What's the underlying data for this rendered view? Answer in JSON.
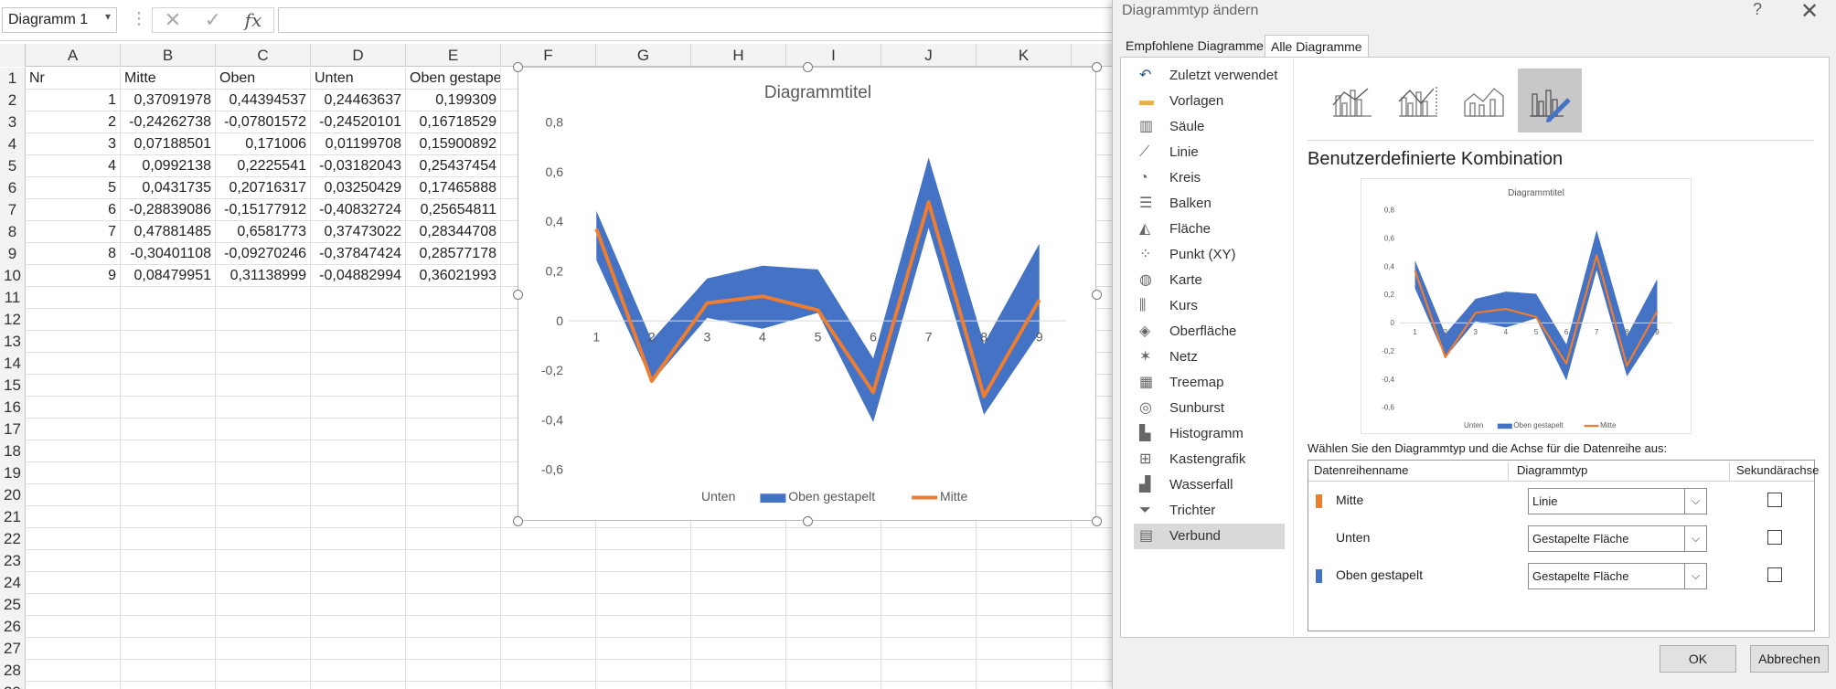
{
  "formula_bar": {
    "name_box": "Diagramm 1",
    "formula": ""
  },
  "columns": [
    "A",
    "B",
    "C",
    "D",
    "E",
    "F",
    "G",
    "H",
    "I",
    "J",
    "K"
  ],
  "row_numbers": [
    "1",
    "2",
    "3",
    "4",
    "5",
    "6",
    "7",
    "8",
    "9",
    "10",
    "11",
    "12",
    "13",
    "14",
    "15",
    "16",
    "17",
    "18",
    "19",
    "20",
    "21",
    "22",
    "23",
    "24",
    "25",
    "26",
    "27",
    "28",
    "29"
  ],
  "table": {
    "headers": [
      "Nr",
      "Mitte",
      "Oben",
      "Unten",
      "Oben gestapelt"
    ],
    "rows": [
      [
        "1",
        "0,37091978",
        "0,44394537",
        "0,24463637",
        "0,199309"
      ],
      [
        "2",
        "-0,24262738",
        "-0,07801572",
        "-0,24520101",
        "0,16718529"
      ],
      [
        "3",
        "0,07188501",
        "0,171006",
        "0,01199708",
        "0,15900892"
      ],
      [
        "4",
        "0,0992138",
        "0,2225541",
        "-0,03182043",
        "0,25437454"
      ],
      [
        "5",
        "0,0431735",
        "0,20716317",
        "0,03250429",
        "0,17465888"
      ],
      [
        "6",
        "-0,28839086",
        "-0,15177912",
        "-0,40832724",
        "0,25654811"
      ],
      [
        "7",
        "0,47881485",
        "0,6581773",
        "0,37473022",
        "0,28344708"
      ],
      [
        "8",
        "-0,30401108",
        "-0,09270246",
        "-0,37847424",
        "0,28577178"
      ],
      [
        "9",
        "0,08479951",
        "0,31138999",
        "-0,04882994",
        "0,36021993"
      ]
    ]
  },
  "chart_data": {
    "type": "line",
    "title": "Diagrammtitel",
    "categories": [
      "1",
      "2",
      "3",
      "4",
      "5",
      "6",
      "7",
      "8",
      "9"
    ],
    "ylim": [
      -0.6,
      0.8
    ],
    "yticks": [
      0.8,
      0.6,
      0.4,
      0.2,
      0,
      -0.2,
      -0.4,
      -0.6
    ],
    "ytick_labels": [
      "0,8",
      "0,6",
      "0,4",
      "0,2",
      "0",
      "-0,2",
      "-0,4",
      "-0,6"
    ],
    "legend_position": "bottom",
    "series": [
      {
        "name": "Unten",
        "kind": "stacked-area",
        "color": "none",
        "values": [
          0.24463637,
          -0.24520101,
          0.01199708,
          -0.03182043,
          0.03250429,
          -0.40832724,
          0.37473022,
          -0.37847424,
          -0.04882994
        ]
      },
      {
        "name": "Oben gestapelt",
        "kind": "stacked-area",
        "color": "#4472c4",
        "values": [
          0.199309,
          0.16718529,
          0.15900892,
          0.25437454,
          0.17465888,
          0.25654811,
          0.28344708,
          0.28577178,
          0.36021993
        ]
      },
      {
        "name": "Mitte",
        "kind": "line",
        "color": "#ed7d31",
        "values": [
          0.37091978,
          -0.24262738,
          0.07188501,
          0.0992138,
          0.0431735,
          -0.28839086,
          0.47881485,
          -0.30401108,
          0.08479951
        ]
      }
    ]
  },
  "dialog": {
    "title": "Diagrammtyp ändern",
    "help": "?",
    "close": "✕",
    "tabs": [
      "Empfohlene Diagramme",
      "Alle Diagramme"
    ],
    "active_tab": "Alle Diagramme",
    "chart_types": [
      {
        "label": "Zuletzt verwendet",
        "icon": "undo-icon"
      },
      {
        "label": "Vorlagen",
        "icon": "folder-icon"
      },
      {
        "label": "Säule",
        "icon": "column-chart-icon"
      },
      {
        "label": "Linie",
        "icon": "line-chart-icon"
      },
      {
        "label": "Kreis",
        "icon": "pie-chart-icon"
      },
      {
        "label": "Balken",
        "icon": "bar-chart-icon"
      },
      {
        "label": "Fläche",
        "icon": "area-chart-icon"
      },
      {
        "label": "Punkt (XY)",
        "icon": "scatter-chart-icon"
      },
      {
        "label": "Karte",
        "icon": "map-chart-icon"
      },
      {
        "label": "Kurs",
        "icon": "stock-chart-icon"
      },
      {
        "label": "Oberfläche",
        "icon": "surface-chart-icon"
      },
      {
        "label": "Netz",
        "icon": "radar-chart-icon"
      },
      {
        "label": "Treemap",
        "icon": "treemap-icon"
      },
      {
        "label": "Sunburst",
        "icon": "sunburst-icon"
      },
      {
        "label": "Histogramm",
        "icon": "histogram-icon"
      },
      {
        "label": "Kastengrafik",
        "icon": "box-whisker-icon"
      },
      {
        "label": "Wasserfall",
        "icon": "waterfall-icon"
      },
      {
        "label": "Trichter",
        "icon": "funnel-icon"
      },
      {
        "label": "Verbund",
        "icon": "combo-chart-icon"
      }
    ],
    "selected_type": "Verbund",
    "combo_title": "Benutzerdefinierte Kombination",
    "preview_title": "Diagrammtitel",
    "preview_ytick_labels": [
      "0,8",
      "0,6",
      "0,4",
      "0,2",
      "0",
      "-0,2",
      "-0,4",
      "-0,6"
    ],
    "preview_legend": [
      "Unten",
      "Oben gestapelt",
      "Mitte"
    ],
    "series_caption": "Wählen Sie den Diagrammtyp und die Achse für die Datenreihe aus:",
    "series_headers": [
      "Datenreihenname",
      "Diagrammtyp",
      "Sekundärachse"
    ],
    "series": [
      {
        "name": "Mitte",
        "type": "Linie",
        "secondary": false,
        "color": "#ed7d31"
      },
      {
        "name": "Unten",
        "type": "Gestapelte Fläche",
        "secondary": false,
        "color": ""
      },
      {
        "name": "Oben gestapelt",
        "type": "Gestapelte Fläche",
        "secondary": false,
        "color": "#4472c4"
      }
    ],
    "ok_label": "OK",
    "cancel_label": "Abbrechen"
  }
}
